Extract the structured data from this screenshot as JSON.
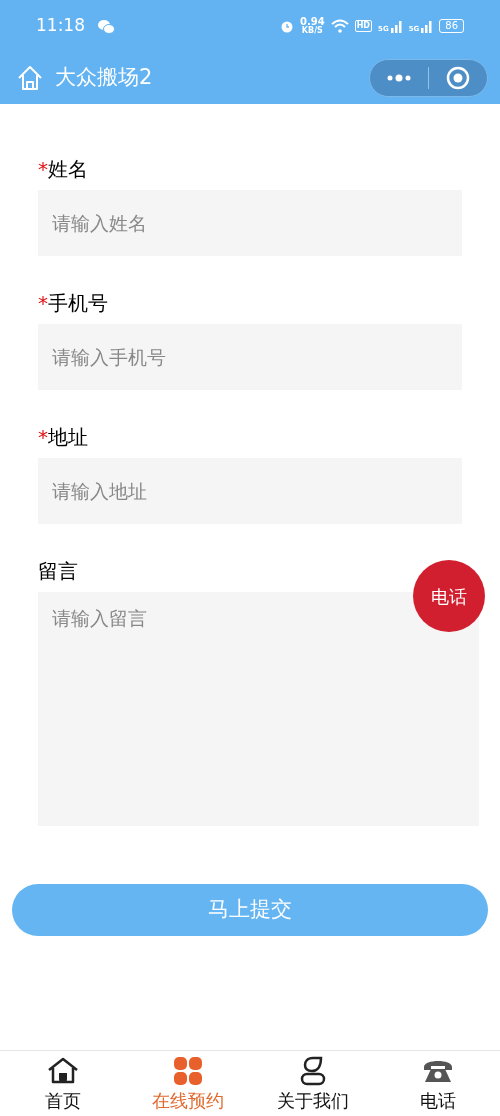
{
  "status_bar": {
    "time": "11:18",
    "speed": "0.94",
    "speed_unit": "KB/S",
    "hd": "HD",
    "signal_1": "5G",
    "signal_2": "5G",
    "battery": "86"
  },
  "nav_bar": {
    "title": "大众搬场2"
  },
  "form": {
    "fields": [
      {
        "kind": "input",
        "label": "姓名",
        "required_mark": "*",
        "placeholder": "请输入姓名"
      },
      {
        "kind": "input",
        "label": "手机号",
        "required_mark": "*",
        "placeholder": "请输入手机号"
      },
      {
        "kind": "input",
        "label": "地址",
        "required_mark": "*",
        "placeholder": "请输入地址"
      },
      {
        "kind": "textarea",
        "label": "留言",
        "placeholder": "请输入留言"
      }
    ],
    "submit": "马上提交"
  },
  "call_button": "电话",
  "tab_bar": [
    {
      "kind": "home",
      "label": "首页",
      "selected": false
    },
    {
      "kind": "grid",
      "label": "在线预约",
      "selected": true
    },
    {
      "kind": "person",
      "label": "关于我们",
      "selected": false
    },
    {
      "kind": "phone",
      "label": "电话",
      "selected": false
    }
  ]
}
